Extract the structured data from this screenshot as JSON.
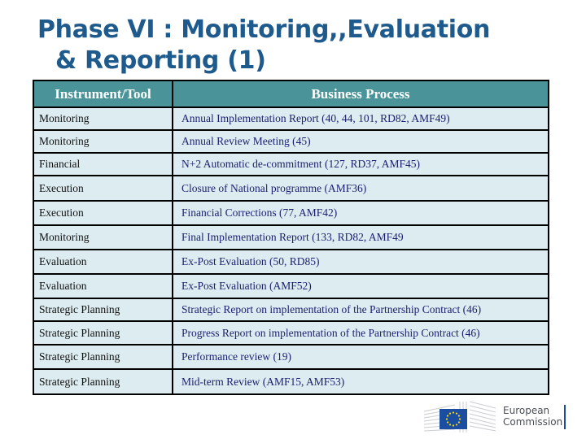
{
  "title": {
    "line1": "Phase VI : Monitoring,,Evaluation",
    "line2": "& Reporting (1)"
  },
  "table": {
    "headers": [
      "Instrument/Tool",
      "Business Process"
    ],
    "rows": [
      {
        "tool": "Monitoring",
        "process": "Annual Implementation Report (40, 44, 101, RD82, AMF49)"
      },
      {
        "tool": "Monitoring",
        "process": "Annual Review Meeting (45)"
      },
      {
        "tool": "Financial",
        "process": "N+2 Automatic de-commitment (127, RD37, AMF45)"
      },
      {
        "tool": "Execution",
        "process": "Closure of  National programme (AMF36)"
      },
      {
        "tool": "Execution",
        "process": "Financial Corrections (77, AMF42)"
      },
      {
        "tool": "Monitoring",
        "process": "Final Implementation Report (133, RD82, AMF49"
      },
      {
        "tool": "Evaluation",
        "process": "Ex-Post Evaluation (50, RD85)"
      },
      {
        "tool": "Evaluation",
        "process": "Ex-Post Evaluation (AMF52)"
      },
      {
        "tool": "Strategic Planning",
        "process": "Strategic Report on implementation of the Partnership Contract (46)"
      },
      {
        "tool": "Strategic Planning",
        "process": "Progress Report on implementation of the Partnership Contract (46)"
      },
      {
        "tool": "Strategic Planning",
        "process": "Performance review (19)"
      },
      {
        "tool": "Strategic Planning",
        "process": "Mid-term Review (AMF15, AMF53)"
      }
    ]
  },
  "logo": {
    "line1": "European",
    "line2": "Commission",
    "icon": "eu-flag-icon"
  },
  "colors": {
    "title": "#1f5a8c",
    "header_bg": "#4a9499",
    "cell_bg": "#dcecf0",
    "process_text": "#1a1f6e",
    "eu_blue": "#1b4ea0",
    "eu_star": "#ffdd00"
  }
}
